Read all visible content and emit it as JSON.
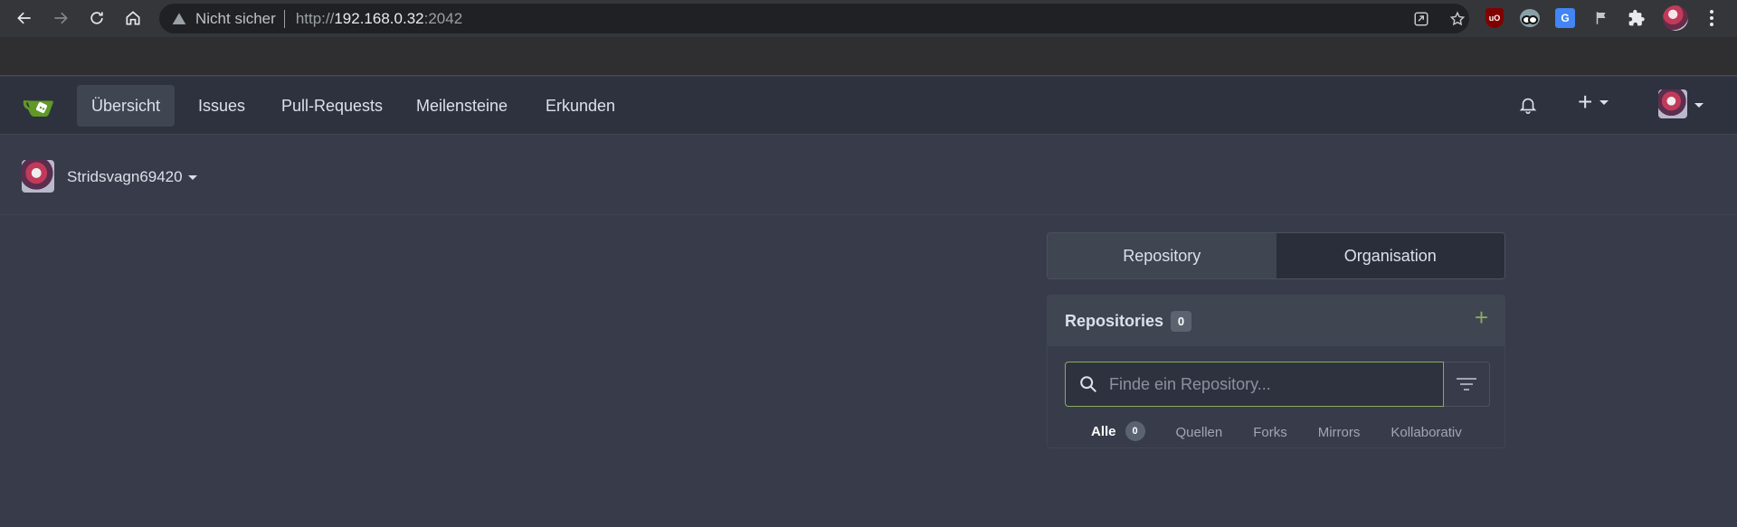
{
  "browser": {
    "security_label": "Nicht sicher",
    "url_scheme": "http://",
    "url_host": "192.168.0.32",
    "url_port": ":2042",
    "extensions": [
      "ublock-origin-icon",
      "glasses-extension-icon",
      "google-translate-icon",
      "flag-icon",
      "extensions-puzzle-icon",
      "profile-avatar"
    ],
    "ublock_label": "uO",
    "translate_label": "G"
  },
  "nav": {
    "items": [
      {
        "label": "Übersicht",
        "active": true
      },
      {
        "label": "Issues"
      },
      {
        "label": "Pull-Requests"
      },
      {
        "label": "Meilensteine"
      },
      {
        "label": "Erkunden"
      }
    ],
    "plus_label": "+"
  },
  "context": {
    "username": "Stridsvagn69420"
  },
  "tabs": {
    "repository": "Repository",
    "organisation": "Organisation"
  },
  "repos": {
    "title": "Repositories",
    "count": "0",
    "add_label": "+",
    "search_placeholder": "Finde ein Repository...",
    "sub_tabs": [
      {
        "label": "Alle",
        "count": "0",
        "active": true
      },
      {
        "label": "Quellen"
      },
      {
        "label": "Forks"
      },
      {
        "label": "Mirrors"
      },
      {
        "label": "Kollaborativ"
      }
    ]
  },
  "colors": {
    "page_bg": "#383c4a",
    "nav_bg": "#2e323e",
    "accent_green": "#87ab63"
  }
}
